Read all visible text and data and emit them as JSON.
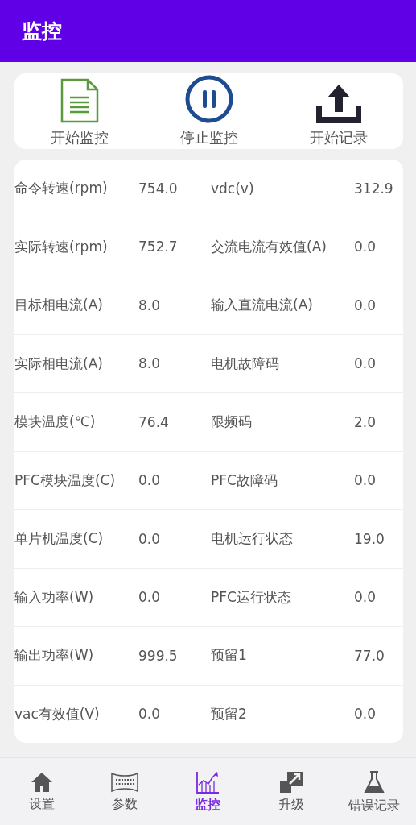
{
  "app_bar": {
    "title": "监控"
  },
  "actions": [
    {
      "kind": "document",
      "label": "开始监控"
    },
    {
      "kind": "pause",
      "label": "停止监控"
    },
    {
      "kind": "upload",
      "label": "开始记录"
    }
  ],
  "readings": [
    {
      "label": "命令转速(rpm)",
      "value": "754.0",
      "label_2": "vdc(v)",
      "value_2": "312.9"
    },
    {
      "label": "实际转速(rpm)",
      "value": "752.7",
      "label_2": "交流电流有效值(A)",
      "value_2": "0.0"
    },
    {
      "label": "目标相电流(A)",
      "value": "8.0",
      "label_2": "输入直流电流(A)",
      "value_2": "0.0"
    },
    {
      "label": "实际相电流(A)",
      "value": "8.0",
      "label_2": "电机故障码",
      "value_2": "0.0"
    },
    {
      "label": "模块温度(℃)",
      "value": "76.4",
      "label_2": "限频码",
      "value_2": "2.0"
    },
    {
      "label": "PFC模块温度(C)",
      "value": "0.0",
      "label_2": "PFC故障码",
      "value_2": "0.0"
    },
    {
      "label": "单片机温度(C)",
      "value": "0.0",
      "label_2": "电机运行状态",
      "value_2": "19.0"
    },
    {
      "label": "输入功率(W)",
      "value": "0.0",
      "label_2": "PFC运行状态",
      "value_2": "0.0"
    },
    {
      "label": "输出功率(W)",
      "value": "999.5",
      "label_2": "预留1",
      "value_2": "77.0"
    },
    {
      "label": "vac有效值(V)",
      "value": "0.0",
      "label_2": "预留2",
      "value_2": "0.0"
    }
  ],
  "bottom_nav": [
    {
      "kind": "home",
      "label": "设置",
      "selected": false
    },
    {
      "kind": "params",
      "label": "参数",
      "selected": false
    },
    {
      "kind": "chart",
      "label": "监控",
      "selected": true
    },
    {
      "kind": "upgrade",
      "label": "升级",
      "selected": false
    },
    {
      "kind": "flask",
      "label": "错误记录",
      "selected": false
    }
  ]
}
